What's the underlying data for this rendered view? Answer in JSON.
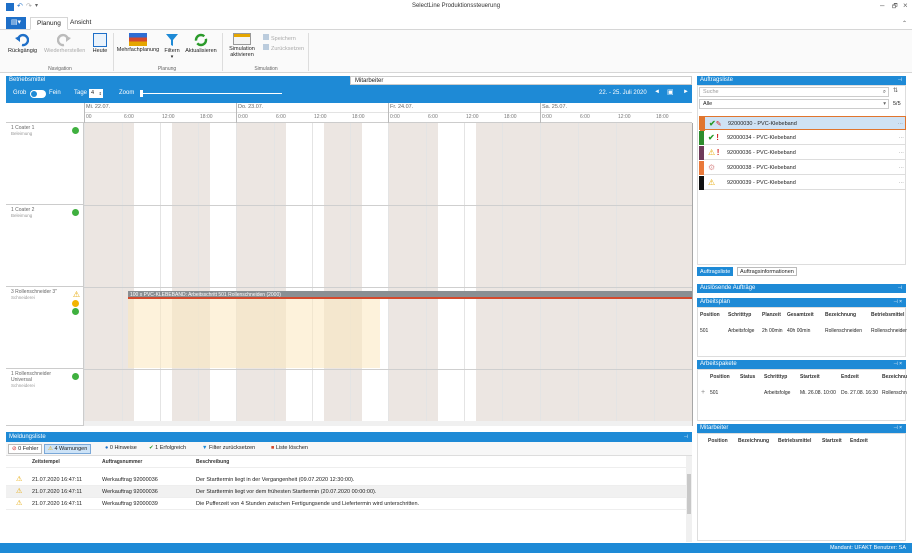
{
  "app": {
    "title": "SelectLine Produktionssteuerung"
  },
  "ribbon": {
    "tabs": [
      "Planung",
      "Ansicht"
    ],
    "buttons": {
      "undo": "Rückgängig",
      "redo": "Wiederherstellen",
      "today": "Heute",
      "multi": "Mehrfachplanung",
      "filter": "Filtern",
      "refresh": "Aktualisieren",
      "simulate": "Simulation aktivieren",
      "save": "Speichern",
      "reset": "Zurücksetzen"
    },
    "groups": {
      "navigation": "Navigation",
      "planung": "Planung",
      "simulation": "Simulation"
    }
  },
  "gantt": {
    "tab_betrieb": "Betriebsmittel",
    "tab_mitarbeiter": "Mitarbeiter",
    "grob": "Grob",
    "fein": "Fein",
    "tage_label": "Tage",
    "tage_value": "4",
    "zoom_label": "Zoom",
    "range": "22. - 25. Juli 2020",
    "days": [
      "Mi. 22.07.",
      "Do. 23.07.",
      "Fr. 24.07.",
      "Sa. 25.07."
    ],
    "hours": [
      "00",
      "6:00",
      "12:00",
      "18:00",
      "0:00",
      "6:00",
      "12:00",
      "18:00",
      "0:00",
      "6:00",
      "12:00",
      "18:00",
      "0:00",
      "6:00",
      "12:00",
      "18:00"
    ],
    "rows": [
      {
        "name": "1 Coater 1",
        "sub": "Beleimung"
      },
      {
        "name": "1 Coater 2",
        "sub": "Beleimung"
      },
      {
        "name": "3 Rollenschneider 3\"",
        "sub": "Schneiderei"
      },
      {
        "name": "1 Rollenschneider Universal",
        "sub": "Schneiderei"
      }
    ],
    "bar_label": "100 x PVC-KLEBEBAND: Arbeitsschritt 501 Rollenschneiden (2000)"
  },
  "meldungen": {
    "title": "Meldungsliste",
    "fehler": "0 Fehler",
    "warnungen": "4 Warnungen",
    "hinweise": "0 Hinweise",
    "erfolg": "1 Erfolgreich",
    "filter_reset": "Filter zurücksetzen",
    "clear": "Liste löschen",
    "columns": [
      "Zeitstempel",
      "Auftragsnummer",
      "Beschreibung"
    ],
    "rows": [
      {
        "time": "21.07.2020 16:47:11",
        "order": "Werkauftrag 92000036",
        "desc": "Der Starttermin liegt in der Vergangenheit (09.07.2020 12:30:00)."
      },
      {
        "time": "21.07.2020 16:47:11",
        "order": "Werkauftrag 92000036",
        "desc": "Der Starttermin liegt vor dem frühesten Starttermin (20.07.2020 00:00:00)."
      },
      {
        "time": "21.07.2020 16:47:11",
        "order": "Werkauftrag 92000039",
        "desc": "Die Pufferzeit von 4 Stunden zwischen Fertigungsende und Liefertermin wird unterschritten."
      }
    ]
  },
  "auftragsliste": {
    "title": "Auftragsliste",
    "search_placeholder": "Suche",
    "filter_value": "Alle",
    "count": "5/5",
    "orders": [
      {
        "label": "92000030 - PVC-Klebeband",
        "color": "#e0752e"
      },
      {
        "label": "92000034 - PVC-Klebeband",
        "color": "#2d8c2d"
      },
      {
        "label": "92000036 - PVC-Klebeband",
        "color": "#6e3a5a"
      },
      {
        "label": "92000038 - PVC-Klebeband",
        "color": "#e9793a"
      },
      {
        "label": "92000039 - PVC-Klebeband",
        "color": "#111111"
      }
    ],
    "tabs": [
      "Auftragsliste",
      "Auftragsinformationen"
    ]
  },
  "ausloesende": {
    "title": "Auslösende Aufträge"
  },
  "arbeitsplan": {
    "title": "Arbeitsplan",
    "columns": [
      "Position",
      "Schritttyp",
      "Planzeit",
      "Gesamtzeit",
      "Bezeichnung",
      "Betriebsmittel"
    ],
    "row": [
      "501",
      "Arbeitsfolge",
      "2h 00min",
      "40h 00min",
      "Rollenschneiden",
      "Rollenschneider"
    ]
  },
  "arbeitspakete": {
    "title": "Arbeitspakete",
    "columns": [
      "Position",
      "Status",
      "Schritttyp",
      "Startzeit",
      "Endzeit",
      "Bezeichnu"
    ],
    "row": [
      "501",
      "",
      "Arbeitsfolge",
      "Mi. 26.08. 10:00",
      "Do. 27.08. 16:30",
      "Rollenschn"
    ]
  },
  "mitarbeiter": {
    "title": "Mitarbeiter",
    "columns": [
      "Position",
      "Bezeichnung",
      "Betriebsmittel",
      "Startzeit",
      "Endzeit"
    ]
  },
  "status": {
    "text": "Mandant: UFAKT   Benutzer: SA"
  },
  "colors": {
    "accent": "#1e8ad6",
    "warning": "#e5a600",
    "error": "#d21f1f",
    "success": "#2a9a2a"
  }
}
